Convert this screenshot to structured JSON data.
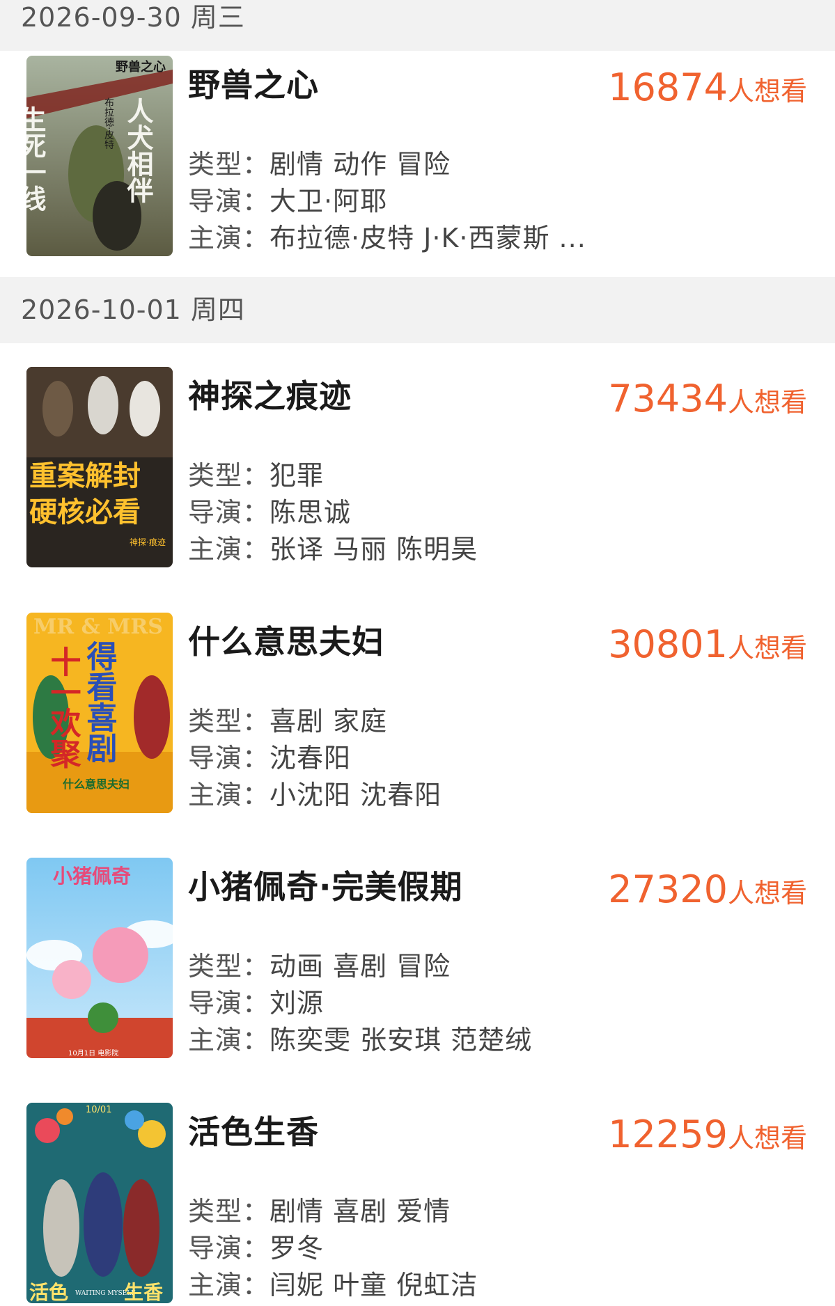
{
  "sections": [
    {
      "date": "2026-09-30 周三",
      "movies": [
        {
          "title": "野兽之心",
          "want_count": "16874",
          "want_suffix": "人想看",
          "genre_label": "类型：",
          "genre": "剧情 动作 冒险",
          "director_label": "导演：",
          "director": "大卫·阿耶",
          "cast_label": "主演：",
          "cast": "布拉德·皮特 J·K·西蒙斯 ...",
          "poster": {
            "title_text": "野兽之心",
            "left_text": "生死一线",
            "right_text": "人犬相伴",
            "side_text": "布拉德·皮特"
          }
        }
      ]
    },
    {
      "date": "2026-10-01 周四",
      "movies": [
        {
          "title": "神探之痕迹",
          "want_count": "73434",
          "want_suffix": "人想看",
          "genre_label": "类型：",
          "genre": "犯罪",
          "director_label": "导演：",
          "director": "陈思诚",
          "cast_label": "主演：",
          "cast": "张译 马丽 陈明昊",
          "poster": {
            "line1": "重案解封",
            "line2": "硬核必看",
            "logo": "神探·痕迹"
          }
        },
        {
          "title": "什么意思夫妇",
          "want_count": "30801",
          "want_suffix": "人想看",
          "genre_label": "类型：",
          "genre": "喜剧 家庭",
          "director_label": "导演：",
          "director": "沈春阳",
          "cast_label": "主演：",
          "cast": "小沈阳 沈春阳",
          "poster": {
            "top_text": "MR & MRS",
            "left_text": "十一欢聚",
            "right_text": "得看喜剧",
            "logo": "什么意思夫妇"
          }
        },
        {
          "title": "小猪佩奇·完美假期",
          "want_count": "27320",
          "want_suffix": "人想看",
          "genre_label": "类型：",
          "genre": "动画 喜剧 冒险",
          "director_label": "导演：",
          "director": "刘源",
          "cast_label": "主演：",
          "cast": "陈奕雯 张安琪 范楚绒",
          "poster": {
            "logo": "小猪佩奇",
            "bottom_text": "10月1日 电影院"
          }
        },
        {
          "title": "活色生香",
          "want_count": "12259",
          "want_suffix": "人想看",
          "genre_label": "类型：",
          "genre": "剧情 喜剧 爱情",
          "director_label": "导演：",
          "director": "罗冬",
          "cast_label": "主演：",
          "cast": "闫妮 叶童 倪虹洁",
          "poster": {
            "date_text": "10/01",
            "bottom_left": "活色",
            "bottom_mid": "WAITING MYSELF",
            "bottom_right": "生香"
          }
        }
      ]
    }
  ]
}
